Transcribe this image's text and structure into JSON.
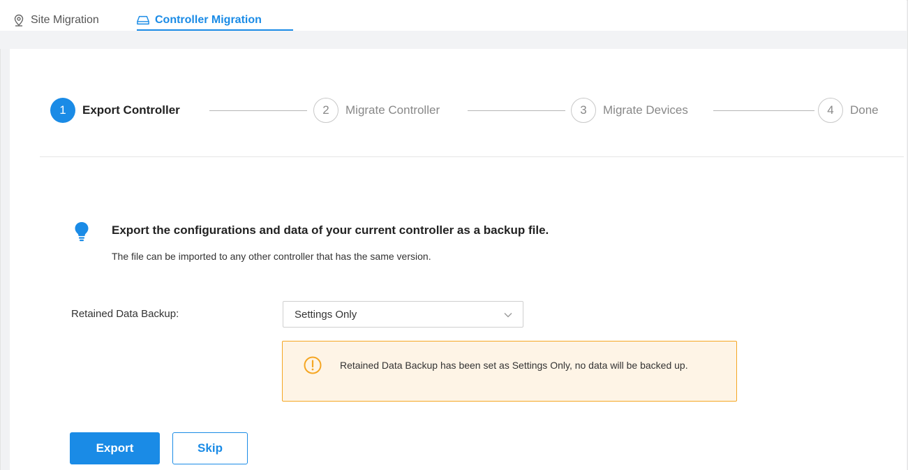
{
  "tabs": [
    {
      "label": "Site Migration",
      "icon": "location-pin-icon",
      "active": false
    },
    {
      "label": "Controller Migration",
      "icon": "controller-icon",
      "active": true
    }
  ],
  "steps": [
    {
      "number": "1",
      "label": "Export Controller",
      "active": true
    },
    {
      "number": "2",
      "label": "Migrate Controller",
      "active": false
    },
    {
      "number": "3",
      "label": "Migrate Devices",
      "active": false
    },
    {
      "number": "4",
      "label": "Done",
      "active": false
    }
  ],
  "info": {
    "icon": "lightbulb-icon",
    "title": "Export the configurations and data of your current controller as a backup file.",
    "subtitle": "The file can be imported to any other controller that has the same version."
  },
  "form": {
    "label": "Retained Data Backup:",
    "selected_value": "Settings Only"
  },
  "warning": {
    "icon": "exclamation-circle-icon",
    "text": "Retained Data Backup has been set as Settings Only, no data will be backed up."
  },
  "buttons": {
    "export_label": "Export",
    "skip_label": "Skip"
  },
  "colors": {
    "accent": "#1a8be6",
    "warning_border": "#f5a623",
    "warning_bg": "#fef4e6"
  }
}
